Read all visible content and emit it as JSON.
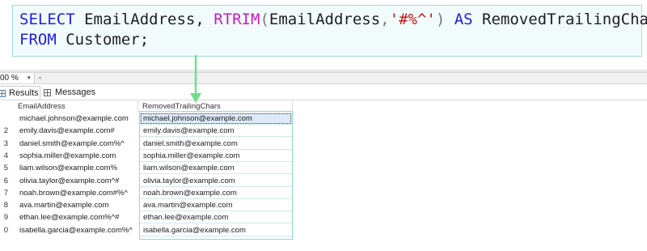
{
  "editor": {
    "line1": {
      "kw_select": "SELECT",
      "col1": " EmailAddress, ",
      "fn_rtrim": "RTRIM",
      "paren_open": "(",
      "arg_col": "EmailAddress",
      "comma": ",",
      "arg_str": "'#%^'",
      "paren_close": ")",
      "kw_as": " AS ",
      "alias": "RemovedTrailingChars"
    },
    "line2": {
      "kw_from": "FROM",
      "table": " Customer;"
    },
    "colors": {
      "keyword": "#1f1fe0",
      "function": "#c21fbc",
      "string": "#c81414",
      "selection_border": "#9fdcdc",
      "arrow": "#6fe08a"
    }
  },
  "zoom": {
    "value": "00 %",
    "caret": "▾",
    "scroll_left": "◂"
  },
  "tabs": {
    "results_label": "Results",
    "messages_label": "Messages"
  },
  "grid": {
    "headers": {
      "email": "EmailAddress",
      "removed": "RemovedTrailingChars"
    },
    "rows": [
      {
        "n": "",
        "email": "michael.johnson@example.com",
        "removed": "michael.johnson@example.com"
      },
      {
        "n": "2",
        "email": "emily.davis@example.com#",
        "removed": "emily.davis@example.com"
      },
      {
        "n": "3",
        "email": "daniel.smith@example.com%^",
        "removed": "daniel.smith@example.com"
      },
      {
        "n": "4",
        "email": "sophia.miller@example.com",
        "removed": "sophia.miller@example.com"
      },
      {
        "n": "5",
        "email": "liam.wilson@example.com%",
        "removed": "liam.wilson@example.com"
      },
      {
        "n": "6",
        "email": "olivia.taylor@example.com^#",
        "removed": "olivia.taylor@example.com"
      },
      {
        "n": "7",
        "email": "noah.brown@example.com#%^",
        "removed": "noah.brown@example.com"
      },
      {
        "n": "8",
        "email": "ava.martin@example.com",
        "removed": "ava.martin@example.com"
      },
      {
        "n": "9",
        "email": "ethan.lee@example.com%^#",
        "removed": "ethan.lee@example.com"
      },
      {
        "n": "0",
        "email": "isabella.garcia@example.com%^",
        "removed": "isabella.garcia@example.com"
      }
    ]
  }
}
